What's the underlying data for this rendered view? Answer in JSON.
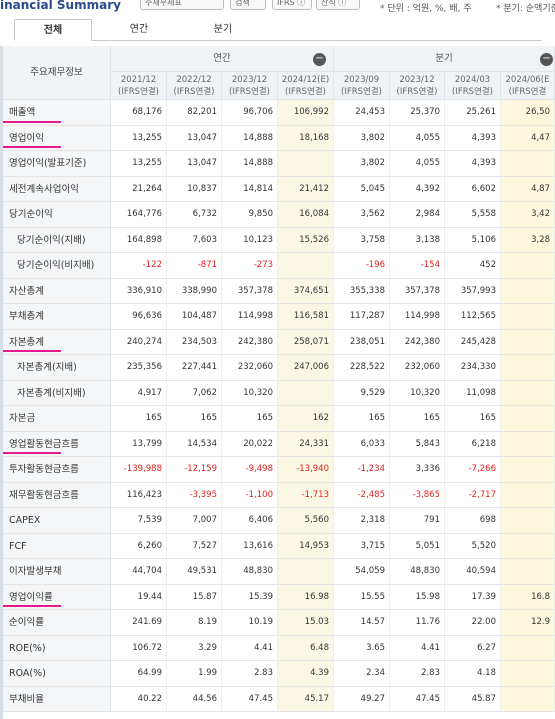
{
  "header": {
    "app_title": "inancial Summary",
    "select_value": "주재무제표",
    "button_label": "검색",
    "ifrs_label": "IFRS ⓘ",
    "filter_label": "산식 ⓘ",
    "unit_text": "* 단위 : 억원, %, 배, 주",
    "fy_text": "* 분기: 순액기준"
  },
  "tabs": [
    {
      "label": "전체",
      "active": true
    },
    {
      "label": "연간",
      "active": false
    },
    {
      "label": "분기",
      "active": false
    }
  ],
  "table": {
    "row_header": "주요재무정보",
    "groups": {
      "annual": "연간",
      "quarterly": "분기",
      "toggle": "−"
    },
    "periods": [
      {
        "top": "2021/12",
        "bottom": "(IFRS연결)"
      },
      {
        "top": "2022/12",
        "bottom": "(IFRS연결)"
      },
      {
        "top": "2023/12",
        "bottom": "(IFRS연결)"
      },
      {
        "top": "2024/12(E)",
        "bottom": "(IFRS연결)"
      },
      {
        "top": "2023/09",
        "bottom": "(IFRS연결)"
      },
      {
        "top": "2023/12",
        "bottom": "(IFRS연결)"
      },
      {
        "top": "2024/03",
        "bottom": "(IFRS연결)"
      },
      {
        "top": "2024/06(E",
        "bottom": "(IFRS연결"
      }
    ],
    "rows": [
      {
        "label": "매출액",
        "hl": true,
        "values": [
          "68,176",
          "82,201",
          "96,706",
          "106,992",
          "24,453",
          "25,370",
          "25,261",
          "26,50"
        ]
      },
      {
        "label": "영업이익",
        "hl": true,
        "values": [
          "13,255",
          "13,047",
          "14,888",
          "18,168",
          "3,802",
          "4,055",
          "4,393",
          "4,47"
        ]
      },
      {
        "label": "영업이익(발표기준)",
        "values": [
          "13,255",
          "13,047",
          "14,888",
          "",
          "3,802",
          "4,055",
          "4,393",
          ""
        ]
      },
      {
        "label": "세전계속사업이익",
        "values": [
          "21,264",
          "10,837",
          "14,814",
          "21,412",
          "5,045",
          "4,392",
          "6,602",
          "4,87"
        ]
      },
      {
        "label": "당기순이익",
        "values": [
          "164,776",
          "6,732",
          "9,850",
          "16,084",
          "3,562",
          "2,984",
          "5,558",
          "3,42"
        ]
      },
      {
        "label": "당기순이익(지배)",
        "sub": true,
        "values": [
          "164,898",
          "7,603",
          "10,123",
          "15,526",
          "3,758",
          "3,138",
          "5,106",
          "3,28"
        ]
      },
      {
        "label": "당기순이익(비지배)",
        "sub": true,
        "values": [
          "-122",
          "-871",
          "-273",
          "",
          "-196",
          "-154",
          "452",
          ""
        ]
      },
      {
        "label": "자산총계",
        "values": [
          "336,910",
          "338,990",
          "357,378",
          "374,651",
          "355,338",
          "357,378",
          "357,993",
          ""
        ]
      },
      {
        "label": "부채총계",
        "values": [
          "96,636",
          "104,487",
          "114,998",
          "116,581",
          "117,287",
          "114,998",
          "112,565",
          ""
        ]
      },
      {
        "label": "자본총계",
        "hl": true,
        "values": [
          "240,274",
          "234,503",
          "242,380",
          "258,071",
          "238,051",
          "242,380",
          "245,428",
          ""
        ]
      },
      {
        "label": "자본총계(지배)",
        "sub": true,
        "values": [
          "235,356",
          "227,441",
          "232,060",
          "247,006",
          "228,522",
          "232,060",
          "234,330",
          ""
        ]
      },
      {
        "label": "자본총계(비지배)",
        "sub": true,
        "values": [
          "4,917",
          "7,062",
          "10,320",
          "",
          "9,529",
          "10,320",
          "11,098",
          ""
        ]
      },
      {
        "label": "자본금",
        "values": [
          "165",
          "165",
          "165",
          "162",
          "165",
          "165",
          "165",
          ""
        ]
      },
      {
        "label": "영업활동현금흐름",
        "hl": true,
        "values": [
          "13,799",
          "14,534",
          "20,022",
          "24,331",
          "6,033",
          "5,843",
          "6,218",
          ""
        ]
      },
      {
        "label": "투자활동현금흐름",
        "values": [
          "-139,988",
          "-12,159",
          "-9,498",
          "-13,940",
          "-1,234",
          "3,336",
          "-7,266",
          ""
        ]
      },
      {
        "label": "재무활동현금흐름",
        "values": [
          "116,423",
          "-3,395",
          "-1,100",
          "-1,713",
          "-2,485",
          "-3,865",
          "-2,717",
          ""
        ]
      },
      {
        "label": "CAPEX",
        "values": [
          "7,539",
          "7,007",
          "6,406",
          "5,560",
          "2,318",
          "791",
          "698",
          ""
        ]
      },
      {
        "label": "FCF",
        "values": [
          "6,260",
          "7,527",
          "13,616",
          "14,953",
          "3,715",
          "5,051",
          "5,520",
          ""
        ]
      },
      {
        "label": "이자발생부채",
        "values": [
          "44,704",
          "49,531",
          "48,830",
          "",
          "54,059",
          "48,830",
          "40,594",
          ""
        ]
      },
      {
        "label": "영업이익률",
        "hl": true,
        "values": [
          "19.44",
          "15.87",
          "15.39",
          "16.98",
          "15.55",
          "15.98",
          "17.39",
          "16.8"
        ]
      },
      {
        "label": "순이익률",
        "values": [
          "241.69",
          "8.19",
          "10.19",
          "15.03",
          "14.57",
          "11.76",
          "22.00",
          "12.9"
        ]
      },
      {
        "label": "ROE(%)",
        "values": [
          "106.72",
          "3.29",
          "4.41",
          "6.48",
          "3.65",
          "4.41",
          "6.27",
          ""
        ]
      },
      {
        "label": "ROA(%)",
        "values": [
          "64.99",
          "1.99",
          "2.83",
          "4.39",
          "2.34",
          "2.83",
          "4.18",
          ""
        ]
      },
      {
        "label": "부채비율",
        "values": [
          "40.22",
          "44.56",
          "47.45",
          "45.17",
          "49.27",
          "47.45",
          "45.87",
          ""
        ]
      }
    ]
  }
}
